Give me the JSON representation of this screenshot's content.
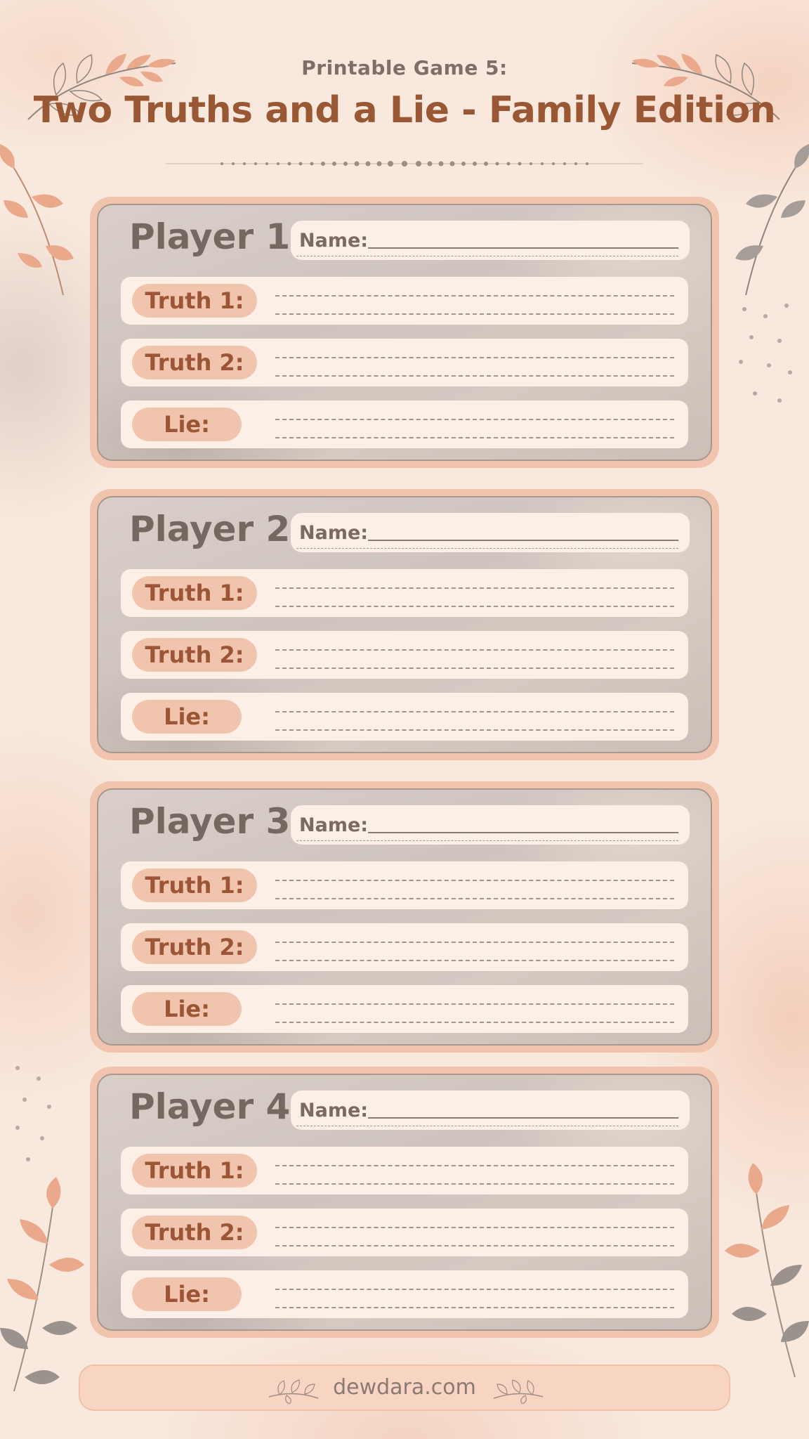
{
  "header": {
    "subtitle": "Printable Game 5:",
    "title": "Two Truths and a Lie - Family Edition"
  },
  "players": [
    {
      "title": "Player 1",
      "name_label": "Name:",
      "rows": [
        {
          "label": "Truth 1:",
          "kind": "truth"
        },
        {
          "label": "Truth 2:",
          "kind": "truth"
        },
        {
          "label": "Lie:",
          "kind": "lie"
        }
      ]
    },
    {
      "title": "Player 2",
      "name_label": "Name:",
      "rows": [
        {
          "label": "Truth 1:",
          "kind": "truth"
        },
        {
          "label": "Truth 2:",
          "kind": "truth"
        },
        {
          "label": "Lie:",
          "kind": "lie"
        }
      ]
    },
    {
      "title": "Player 3",
      "name_label": "Name:",
      "rows": [
        {
          "label": "Truth 1:",
          "kind": "truth"
        },
        {
          "label": "Truth 2:",
          "kind": "truth"
        },
        {
          "label": "Lie:",
          "kind": "lie"
        }
      ]
    },
    {
      "title": "Player 4",
      "name_label": "Name:",
      "rows": [
        {
          "label": "Truth 1:",
          "kind": "truth"
        },
        {
          "label": "Truth 2:",
          "kind": "truth"
        },
        {
          "label": "Lie:",
          "kind": "lie"
        }
      ]
    }
  ],
  "footer": {
    "site": "dewdara.com"
  },
  "colors": {
    "title": "#9a5734",
    "pill": "#f1c4ae",
    "pill_text": "#9c5635",
    "card_frame": "#f1c4ae"
  }
}
